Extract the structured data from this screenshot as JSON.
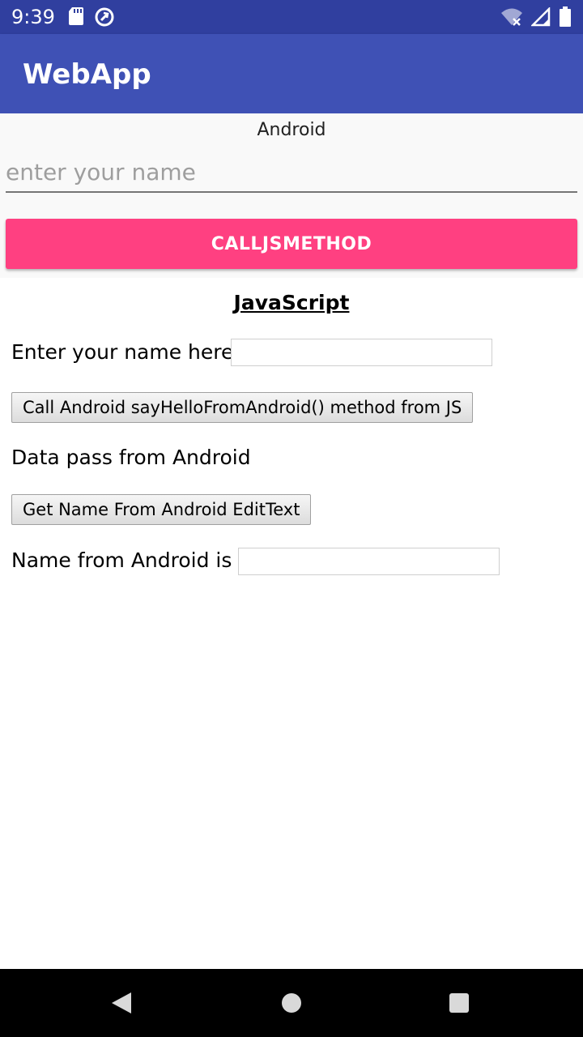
{
  "status_bar": {
    "time": "9:39",
    "left_icons": [
      "sd-card-icon",
      "sync-icon"
    ],
    "right_icons": [
      "wifi-off-icon",
      "signal-icon",
      "battery-icon"
    ]
  },
  "app_bar": {
    "title": "WebApp"
  },
  "android_section": {
    "label": "Android",
    "name_input": {
      "value": "",
      "placeholder": "enter your name"
    },
    "call_js_button": "CALLJSMETHOD"
  },
  "web_section": {
    "heading": "JavaScript",
    "enter_name_label": "Enter your name here",
    "enter_name_value": "",
    "say_hello_button": "Call Android sayHelloFromAndroid() method from JS",
    "data_pass_text": "Data pass from Android",
    "get_name_button": "Get Name From Android EditText",
    "name_from_android_label": "Name from Android is",
    "name_from_android_value": ""
  },
  "nav_bar": {
    "buttons": [
      "back-icon",
      "home-icon",
      "recents-icon"
    ]
  }
}
